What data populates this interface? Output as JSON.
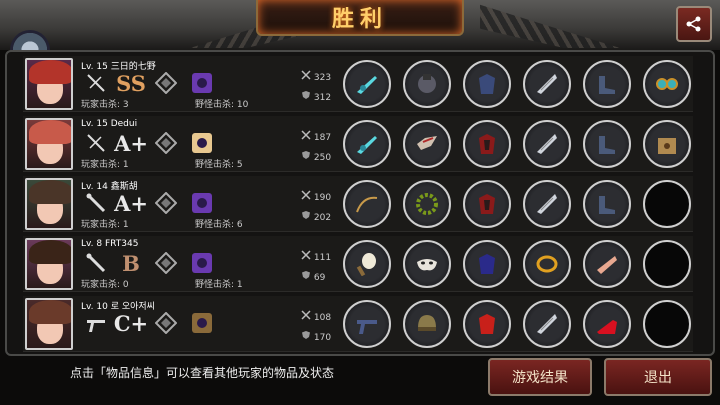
{
  "header": {
    "title": "胜利",
    "subtitle_partial": "三日的七野"
  },
  "footer": {
    "hint": "点击「物品信息」可以查看其他玩家的物品及状态",
    "result_button": "游戏结果",
    "exit_button": "退出"
  },
  "players": [
    {
      "level": "Lv. 15",
      "name": "三日的七野",
      "rank": "SS",
      "player_kills": "玩家击杀: 3",
      "monster_kills": "野怪击杀: 10",
      "attack": "323",
      "defense": "312",
      "items": [
        "cyan-gun-icon",
        "glove-icon",
        "armor-icon",
        "blade-icon",
        "boots-icon",
        "goggles-icon"
      ]
    },
    {
      "level": "Lv. 15",
      "name": "Dedui",
      "rank": "A+",
      "player_kills": "玩家击杀: 1",
      "monster_kills": "野怪击杀: 5",
      "attack": "187",
      "defense": "250",
      "items": [
        "cyan-gun-icon",
        "wing-helmet-icon",
        "red-armor-icon",
        "blade-icon",
        "boots-icon",
        "box-icon"
      ]
    },
    {
      "level": "Lv. 14",
      "name": "鑫斯胡",
      "rank": "A+",
      "player_kills": "玩家击杀: 1",
      "monster_kills": "野怪击杀: 6",
      "attack": "190",
      "defense": "202",
      "items": [
        "whip-icon",
        "laurel-icon",
        "red-armor-icon",
        "blade-icon",
        "boots-icon",
        "empty"
      ]
    },
    {
      "level": "Lv. 8",
      "name": "FRT345",
      "rank": "B",
      "player_kills": "玩家击杀: 0",
      "monster_kills": "野怪击杀: 1",
      "attack": "111",
      "defense": "69",
      "items": [
        "club-icon",
        "mask-icon",
        "blue-armor-icon",
        "bracelet-icon",
        "arm-icon",
        "empty"
      ]
    },
    {
      "level": "Lv. 10",
      "name": "로 오아저씨",
      "rank": "C+",
      "player_kills": "",
      "monster_kills": "",
      "attack": "108",
      "defense": "170",
      "items": [
        "pistol-icon",
        "helmet-icon",
        "red-suit-icon",
        "blade-icon",
        "heels-icon",
        "empty"
      ]
    }
  ],
  "colors": {
    "gold": "#ffcf6a",
    "button_red": "#7a2622",
    "rank_ss": "#e0a060",
    "rank_b": "#c09070"
  }
}
